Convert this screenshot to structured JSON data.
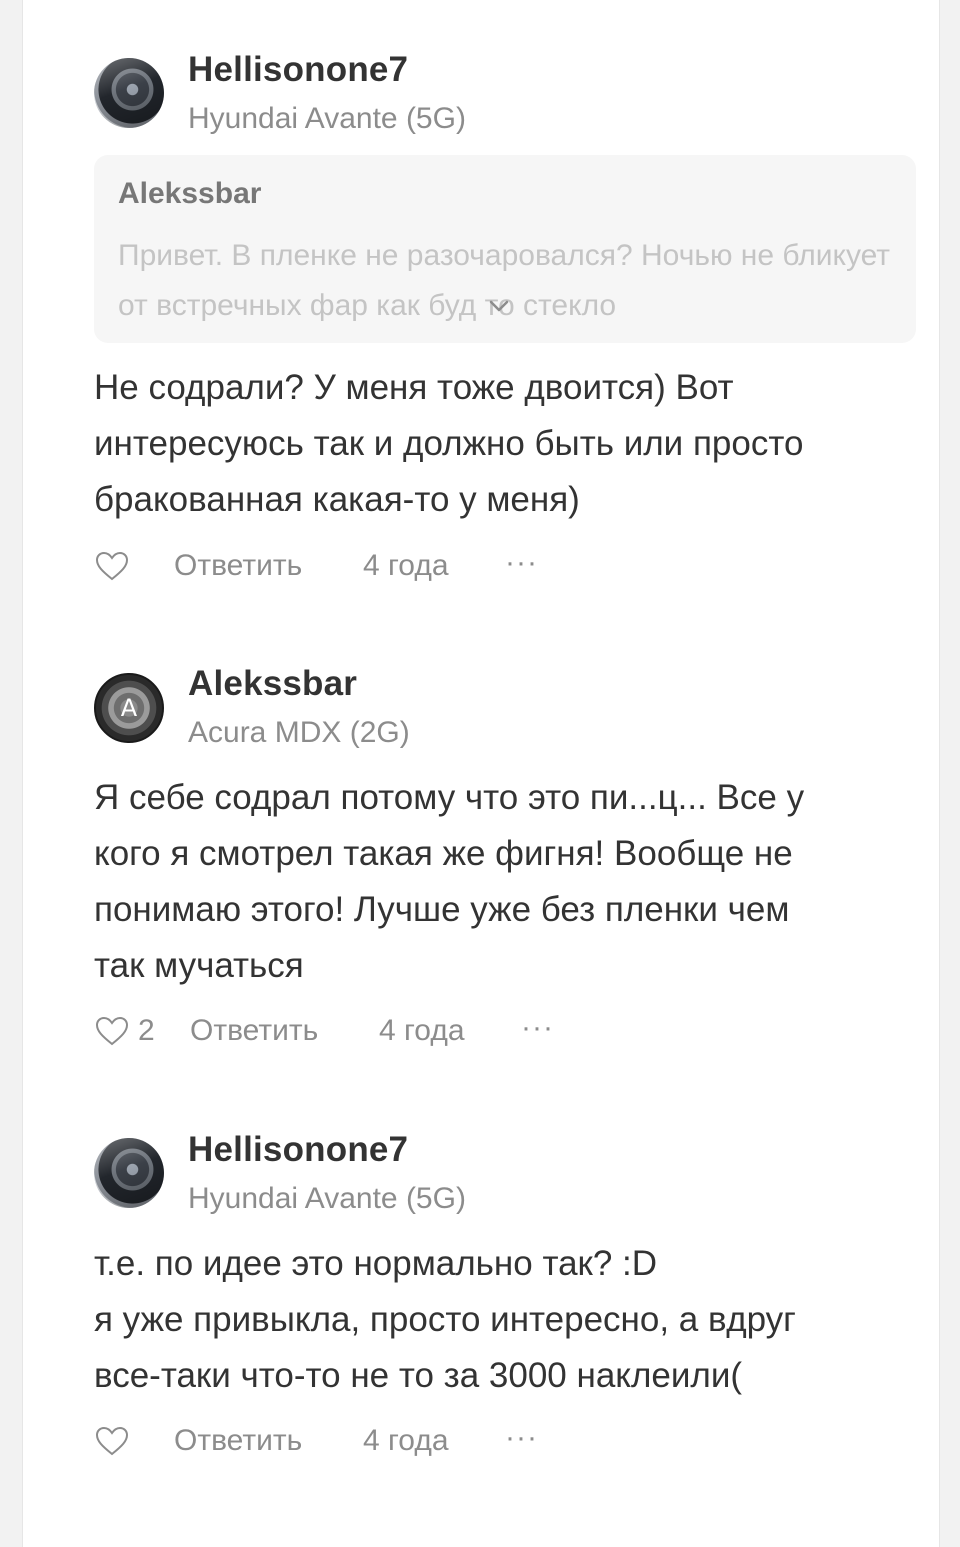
{
  "comments": [
    {
      "author": "Hellisonone7",
      "car": "Hyundai Avante (5G)",
      "quote": {
        "author": "Alekssbar",
        "text": "Привет. В пленке не разочаровался? Ночью не бликует от встречных фар как буд то стекло"
      },
      "text": "Не содрали? У меня тоже двоится) Вот\nинтересуюсь так и должно быть или просто\nбракованная какая-то у меня)",
      "likes": "",
      "reply_label": "Ответить",
      "time": "4 года",
      "more": "···"
    },
    {
      "author": "Alekssbar",
      "avatar_letter": "A",
      "car": "Acura MDX (2G)",
      "text": "Я себе содрал потому что это пи...ц... Все у\nкого я смотрел такая же фигня! Вообще не\nпонимаю этого! Лучше уже без пленки чем\nтак мучаться",
      "likes": "2",
      "reply_label": "Ответить",
      "time": "4 года",
      "more": "···"
    },
    {
      "author": "Hellisonone7",
      "car": "Hyundai Avante (5G)",
      "text": "т.е. по идее это нормально так? :D\nя уже привыкла, просто интересно, а вдруг\nвсе-таки что-то не то за 3000 наклеили(",
      "likes": "",
      "reply_label": "Ответить",
      "time": "4 года",
      "more": "···"
    }
  ],
  "colors": {
    "text": "#333333",
    "secondary": "#8c8c8c",
    "quote_bg": "#f6f6f6"
  }
}
